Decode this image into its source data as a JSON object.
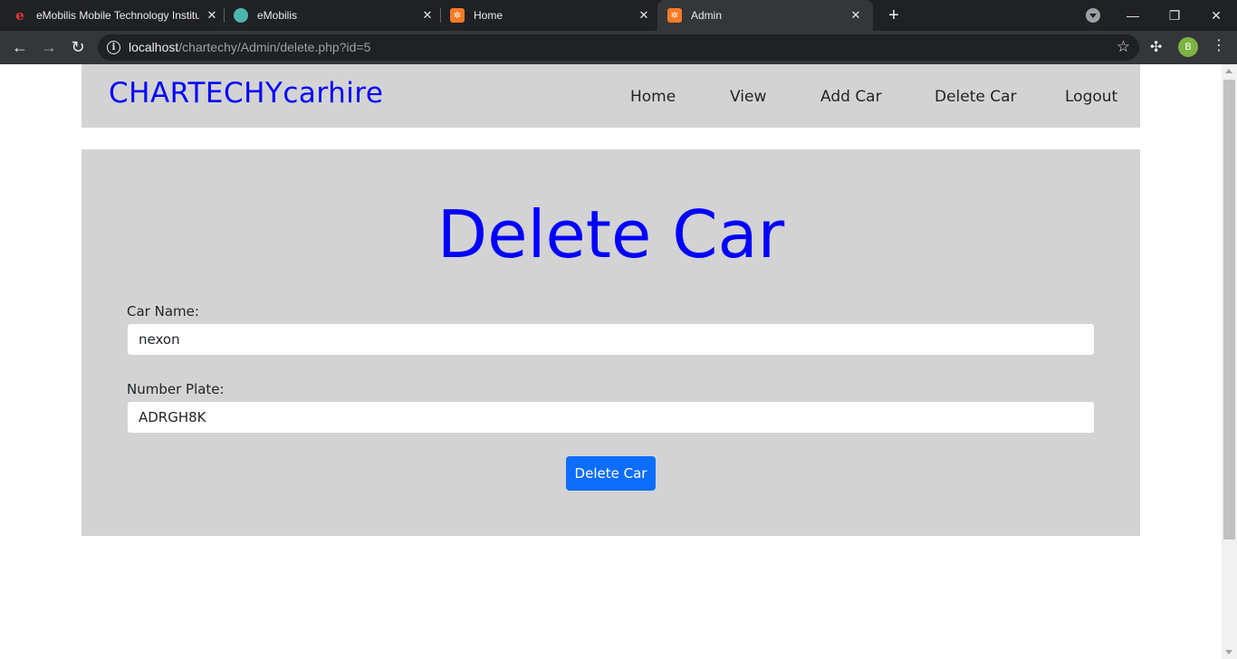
{
  "browser": {
    "tabs": [
      {
        "title": "eMobilis Mobile Technology Institute",
        "favicon": "e"
      },
      {
        "title": "eMobilis",
        "favicon": "doc"
      },
      {
        "title": "Home",
        "favicon": "xampp"
      },
      {
        "title": "Admin",
        "favicon": "xampp"
      }
    ],
    "url_host": "localhost",
    "url_path": "/chartechy/Admin/delete.php?id=5",
    "profile_initial": "B"
  },
  "site": {
    "brand": "CHARTECHYcarhire",
    "nav": [
      "Home",
      "View",
      "Add Car",
      "Delete Car",
      "Logout"
    ]
  },
  "form": {
    "heading": "Delete Car",
    "car_name_label": "Car Name:",
    "car_name_value": "nexon",
    "plate_label": "Number Plate:",
    "plate_value": "ADRGH8K",
    "submit_label": "Delete Car"
  },
  "colors": {
    "brand": "#0000ff",
    "panel": "#d3d3d3",
    "button": "#0d6efd"
  }
}
